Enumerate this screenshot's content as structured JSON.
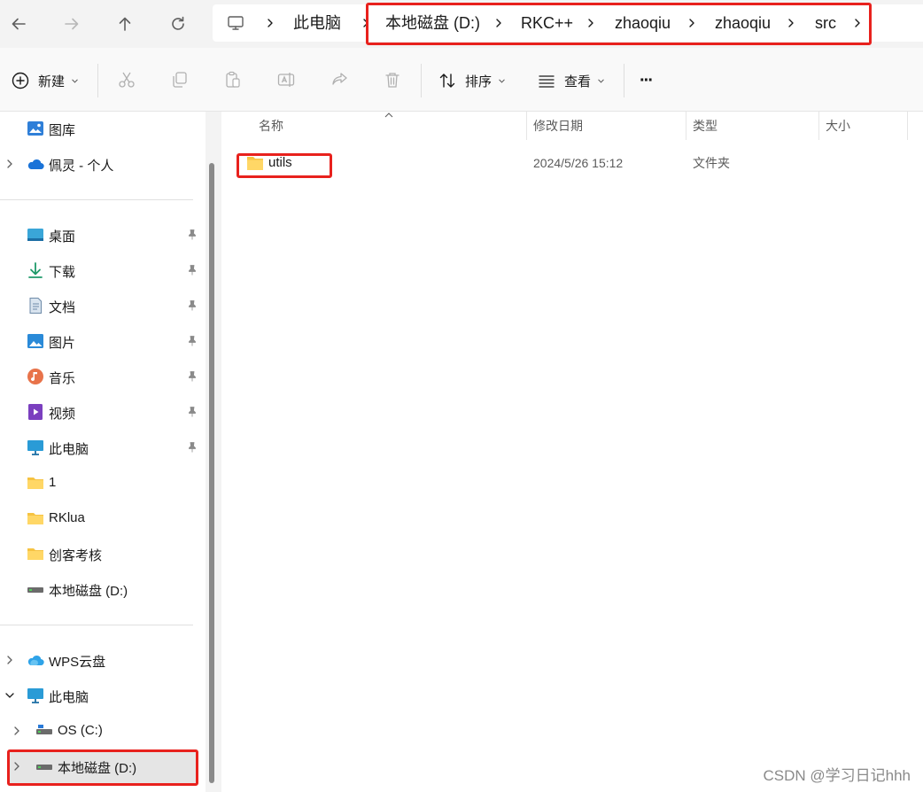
{
  "nav": {
    "back_icon": "arrow-left-icon",
    "forward_icon": "arrow-right-icon",
    "up_icon": "arrow-up-icon",
    "refresh_icon": "refresh-icon"
  },
  "breadcrumb": {
    "items": [
      "此电脑",
      "本地磁盘 (D:)",
      "RKC++",
      "zhaoqiu",
      "zhaoqiu",
      "src"
    ]
  },
  "commands": {
    "new_label": "新建",
    "sort_label": "排序",
    "view_label": "查看",
    "more_label": "···"
  },
  "sidebar": {
    "items": [
      {
        "label": "图库",
        "icon": "gallery-icon"
      },
      {
        "label": "佩灵 - 个人",
        "icon": "onedrive-cloud-icon"
      },
      {
        "label": "桌面",
        "icon": "desktop-icon"
      },
      {
        "label": "下载",
        "icon": "download-icon"
      },
      {
        "label": "文档",
        "icon": "document-icon"
      },
      {
        "label": "图片",
        "icon": "picture-icon"
      },
      {
        "label": "音乐",
        "icon": "music-icon"
      },
      {
        "label": "视频",
        "icon": "video-icon"
      },
      {
        "label": "此电脑",
        "icon": "computer-icon"
      },
      {
        "label": "1",
        "icon": "folder-icon"
      },
      {
        "label": "RKlua",
        "icon": "folder-icon"
      },
      {
        "label": "创客考核",
        "icon": "folder-icon"
      },
      {
        "label": "本地磁盘 (D:)",
        "icon": "drive-icon"
      },
      {
        "label": "WPS云盘",
        "icon": "wps-cloud-icon"
      },
      {
        "label": "此电脑",
        "icon": "computer-icon"
      },
      {
        "label": "OS (C:)",
        "icon": "drive-icon"
      },
      {
        "label": "本地磁盘 (D:)",
        "icon": "drive-icon"
      }
    ]
  },
  "table": {
    "headers": {
      "name": "名称",
      "date": "修改日期",
      "type": "类型",
      "size": "大小"
    },
    "rows": [
      {
        "name": "utils",
        "date": "2024/5/26 15:12",
        "type": "文件夹",
        "size": ""
      }
    ]
  },
  "colors": {
    "highlight": "#e8211d",
    "folder": "#f6c342"
  },
  "watermark": "CSDN @学习日记hhh"
}
